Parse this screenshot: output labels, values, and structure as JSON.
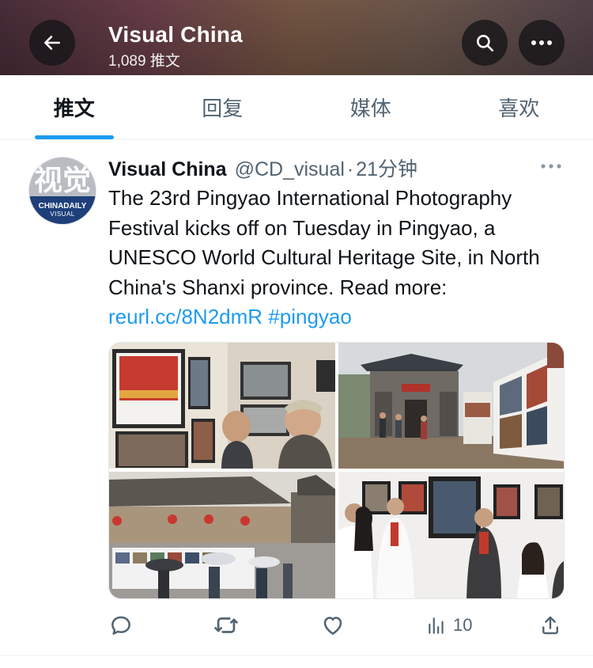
{
  "header": {
    "title": "Visual China",
    "post_count": "1,089 推文",
    "icons": {
      "back": "arrow-left-icon",
      "search": "search-icon",
      "more": "more-horizontal-icon"
    }
  },
  "tabs": [
    {
      "label": "推文",
      "active": true
    },
    {
      "label": "回复",
      "active": false
    },
    {
      "label": "媒体",
      "active": false
    },
    {
      "label": "喜欢",
      "active": false
    }
  ],
  "tweet": {
    "avatar": {
      "glyph": "视觉",
      "brand_line1": "CHINADAILY",
      "brand_line2": "VISUAL"
    },
    "author_name": "Visual China",
    "handle": "@CD_visual",
    "separator": "·",
    "time": "21分钟",
    "text": "The 23rd Pingyao International Photography Festival kicks off on Tuesday in Pingyao, a UNESCO World Cultural Heritage Site, in North China's Shanxi province. Read more: ",
    "link": "reurl.cc/8N2dmR",
    "hashtag": "#pingyao",
    "photos": [
      {
        "name": "photo-exhibition-viewers"
      },
      {
        "name": "photo-gate-courtyard"
      },
      {
        "name": "photo-rain-umbrellas"
      },
      {
        "name": "photo-gallery-visitors"
      }
    ],
    "actions": {
      "reply_icon": "reply-icon",
      "retweet_icon": "retweet-icon",
      "like_icon": "heart-icon",
      "views_icon": "views-chart-icon",
      "views_count": "10",
      "share_icon": "share-icon"
    }
  },
  "colors": {
    "accent": "#1d9bf0",
    "text_primary": "#0f1419",
    "text_secondary": "#536471"
  }
}
